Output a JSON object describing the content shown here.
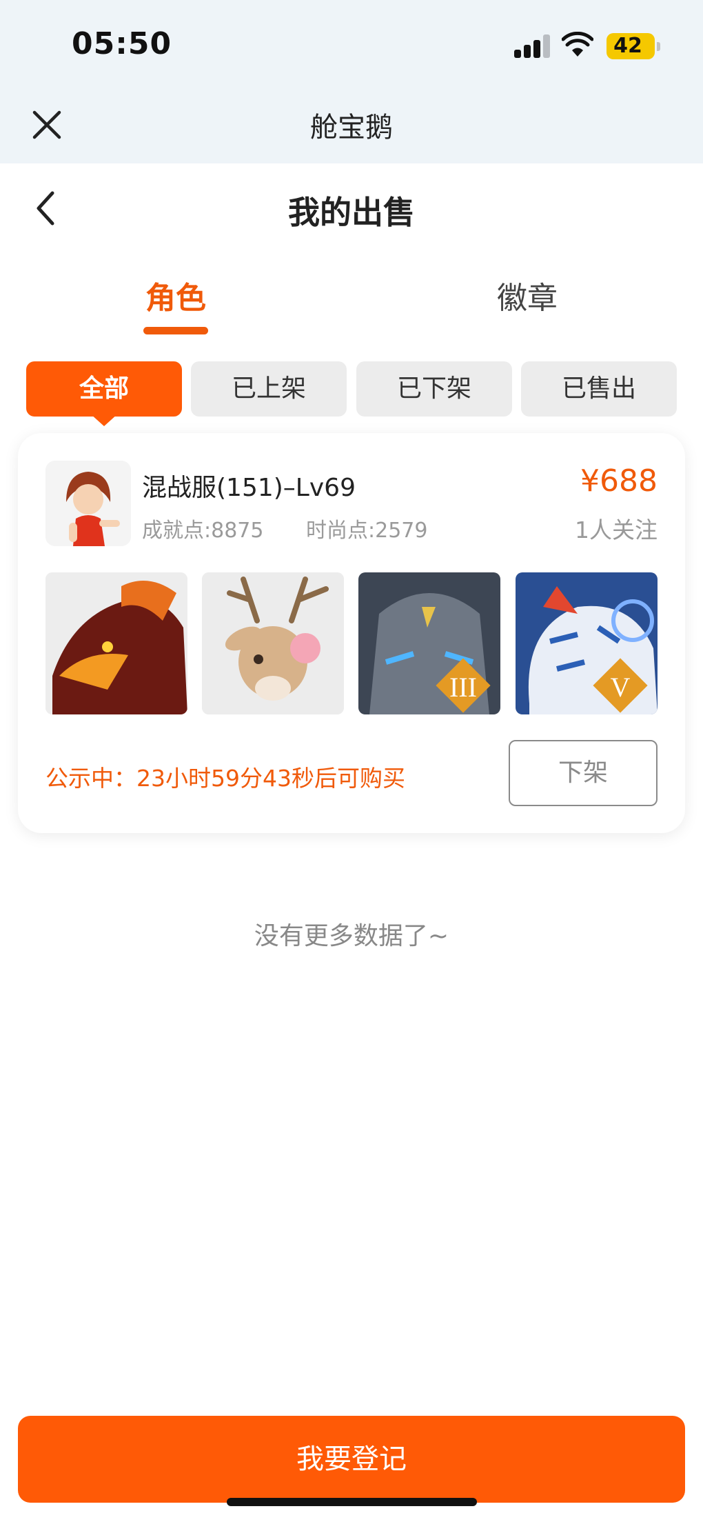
{
  "status_bar": {
    "time": "05:50",
    "battery": "42"
  },
  "mini_program": {
    "title": "舱宝鹅"
  },
  "header": {
    "title": "我的出售"
  },
  "tabs": [
    {
      "label": "角色",
      "active": true
    },
    {
      "label": "徽章",
      "active": false
    }
  ],
  "filters": [
    {
      "label": "全部",
      "active": true
    },
    {
      "label": "已上架",
      "active": false
    },
    {
      "label": "已下架",
      "active": false
    },
    {
      "label": "已售出",
      "active": false
    }
  ],
  "listing": {
    "title": "混战服(151)–Lv69",
    "achievement": "成就点:8875",
    "fashion": "时尚点:2579",
    "price": "¥688",
    "followers": "1人关注",
    "thumbnails": [
      {
        "icon": "dragon-pet",
        "badge": ""
      },
      {
        "icon": "deer-pet",
        "badge": ""
      },
      {
        "icon": "stone-golem-pet",
        "badge": "III"
      },
      {
        "icon": "white-tiger-pet",
        "badge": "V"
      }
    ],
    "notice": "公示中：23小时59分43秒后可购买",
    "delist_label": "下架"
  },
  "no_more_text": "没有更多数据了~",
  "register_label": "我要登记",
  "colors": {
    "accent": "#ff5a06",
    "accent_text": "#f05a0a",
    "topbar_bg": "#eef4f8"
  }
}
